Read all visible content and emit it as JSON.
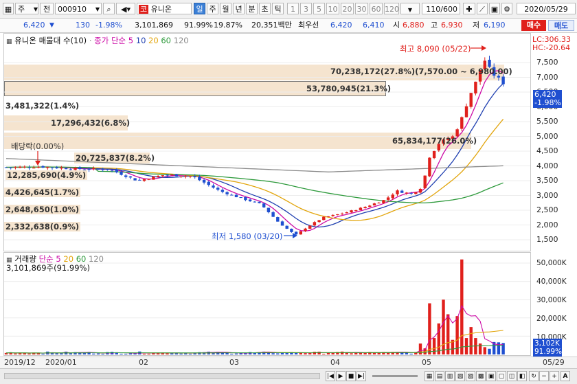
{
  "toolbar": {
    "stock_type": "주",
    "scope": "전",
    "code": "000910",
    "name": "유니온",
    "market_badge": "코",
    "periods": [
      "일",
      "주",
      "월",
      "년",
      "분",
      "초",
      "틱"
    ],
    "active_period": "일",
    "intervals": [
      "1",
      "3",
      "5",
      "10",
      "20",
      "30",
      "60",
      "120"
    ],
    "count": "110/600",
    "date": "2020/05/29"
  },
  "quote": {
    "price": "6,420",
    "change": "130",
    "change_pct": "-1.98%",
    "volume": "3,101,869",
    "vol_ratio": "91.99%",
    "turnover": "19.87%",
    "amount": "20,351백만",
    "best_label": "최우선",
    "ask": "6,420",
    "bid": "6,410",
    "open_label": "시",
    "open": "6,880",
    "high_label": "고",
    "high": "6,930",
    "low_label": "저",
    "low": "6,190",
    "buy_label": "매수",
    "sell_label": "매도"
  },
  "price_panel": {
    "title": "유니온 매물대 수(10)",
    "ma_label": "종가 단순",
    "ma_periods": [
      "5",
      "10",
      "20",
      "60",
      "120"
    ],
    "lc": "LC:306.33",
    "hc": "HC:-20.64",
    "y_ticks": [
      "7,500",
      "7,000",
      "6,500",
      "6,000",
      "5,500",
      "5,000",
      "4,500",
      "4,000",
      "3,500",
      "3,000",
      "2,500",
      "2,000",
      "1,500"
    ],
    "current_price": "6,420",
    "current_pct": "-1.98%",
    "high_note": "최고 8,090 (05/22)",
    "low_note": "최저 1,580 (03/20)",
    "dividend_note": "배당락(0.00%)"
  },
  "profile_labels": [
    "70,238,172(27.8%)(7,570.00 ~ 6,980.00)",
    "53,780,945(21.3%)",
    "3,481,322(1.4%)",
    "17,296,432(6.8%)",
    "65,834,177(26.0%)",
    "20,725,837(8.2%)",
    "12,285,690(4.9%)",
    "4,426,645(1.7%)",
    "2,648,650(1.0%)",
    "2,332,638(0.9%)"
  ],
  "volume_panel": {
    "title": "거래량",
    "ma_label": "단순",
    "ma_periods": [
      "5",
      "20",
      "60",
      "120"
    ],
    "summary": "3,101,869주(91.99%)",
    "y_ticks": [
      "50,000K",
      "40,000K",
      "30,000K",
      "20,000K",
      "10,000K"
    ],
    "current_value": "3,102K",
    "current_pct": "91.99%"
  },
  "x_axis": {
    "labels": [
      "2019/12",
      "2020/01",
      "02",
      "03",
      "04",
      "05"
    ],
    "end_label": "05/29"
  },
  "colors": {
    "up": "#e0201c",
    "down": "#1f4fd0",
    "ma5": "#cc0aa6",
    "ma10": "#1f3fb0",
    "ma20": "#e2a50c",
    "ma60": "#2e9a3c",
    "ma120": "#8a8a8a",
    "band": "#f5e4cf"
  },
  "chart_data": {
    "type": "candlestick",
    "x": [
      "2019-12",
      "2020-01",
      "2020-02",
      "2020-03",
      "2020-03-20",
      "2020-04",
      "2020-05",
      "2020-05-22",
      "2020-05-29"
    ],
    "close": [
      3950,
      3800,
      3650,
      2950,
      1580,
      2350,
      3100,
      8090,
      6420
    ],
    "ylim": [
      1250,
      8300
    ],
    "volume_ylim": [
      0,
      55000
    ]
  }
}
